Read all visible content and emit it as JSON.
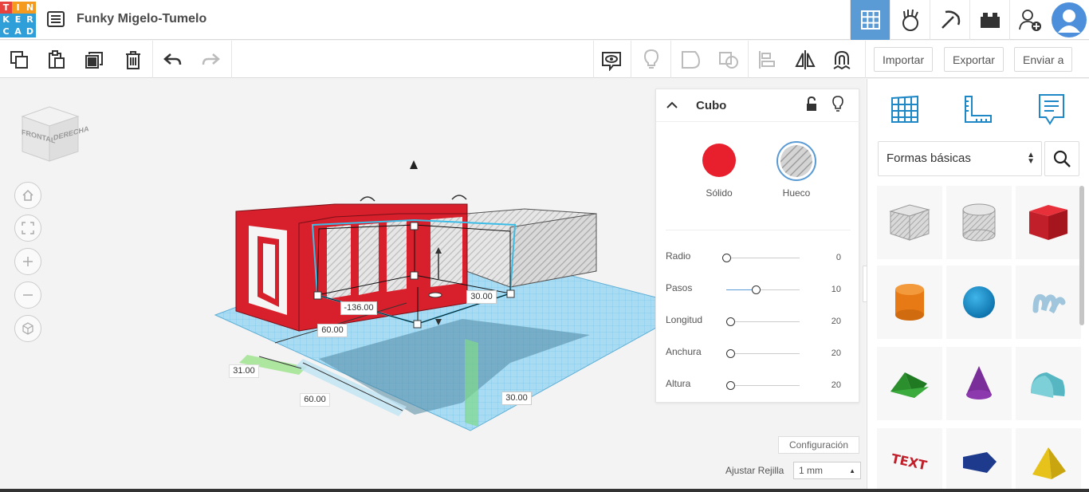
{
  "app": {
    "logo_letters": [
      "T",
      "I",
      "N",
      "K",
      "E",
      "R",
      "C",
      "A",
      "D"
    ],
    "logo_colors": [
      "#e8423f",
      "#f49b1f",
      "#f49b1f",
      "#2e9fd8",
      "#2e9fd8",
      "#2e9fd8",
      "#2e9fd8",
      "#2e9fd8",
      "#2e9fd8"
    ],
    "project_title": "Funky Migelo-Tumelo"
  },
  "top_icons": [
    "grid-view-icon",
    "blocks-hand-icon",
    "minecraft-pickaxe-icon",
    "lego-brick-icon",
    "add-user-icon",
    "avatar"
  ],
  "toolbar": {
    "import_label": "Importar",
    "export_label": "Exportar",
    "send_label": "Enviar a"
  },
  "viewcube": {
    "front_label": "FRONTAL",
    "right_label": "DERECHA"
  },
  "dimensions": {
    "d1": "-136.00",
    "d2": "30.00",
    "d3": "60.00",
    "d4": "31.00",
    "d5": "60.00",
    "d6": "30.00"
  },
  "inspector": {
    "title": "Cubo",
    "solid_label": "Sólido",
    "hole_label": "Hueco",
    "solid_color": "#e8202e",
    "properties": [
      {
        "label": "Radio",
        "value": "0",
        "level": 0.0
      },
      {
        "label": "Pasos",
        "value": "10",
        "level": 0.4
      },
      {
        "label": "Longitud",
        "value": "20",
        "level": 0.05
      },
      {
        "label": "Anchura",
        "value": "20",
        "level": 0.05
      },
      {
        "label": "Altura",
        "value": "20",
        "level": 0.05
      }
    ]
  },
  "right_panel": {
    "category": "Formas básicas",
    "shapes": [
      "box-hole",
      "cylinder-hole",
      "box",
      "cylinder",
      "sphere",
      "scribble",
      "roof",
      "cone",
      "round-roof",
      "text",
      "polygon",
      "pyramid"
    ]
  },
  "footer": {
    "config_label": "Configuración",
    "snap_label": "Ajustar Rejilla",
    "snap_value": "1 mm"
  },
  "colors": {
    "accent": "#5b9bd5",
    "red": "#d8202c",
    "workplane_blue": "#8fd0ef"
  }
}
